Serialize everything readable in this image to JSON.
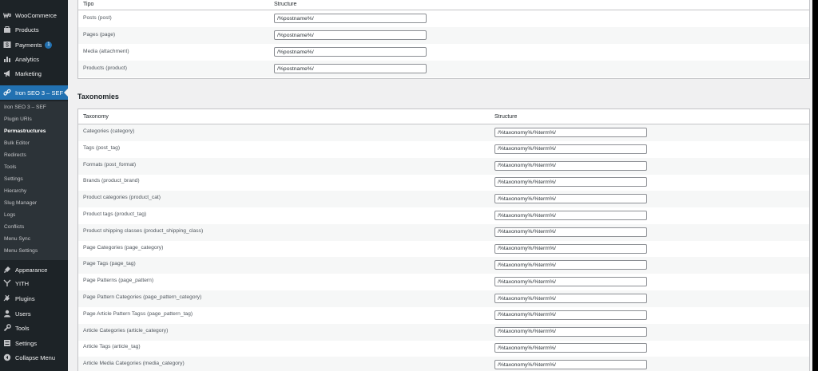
{
  "sidebar": {
    "top_items": [
      {
        "label": "WooCommerce",
        "icon": "woocommerce-icon"
      },
      {
        "label": "Products",
        "icon": "products-icon"
      },
      {
        "label": "Payments",
        "icon": "payments-icon",
        "badge": "1"
      },
      {
        "label": "Analytics",
        "icon": "analytics-icon"
      },
      {
        "label": "Marketing",
        "icon": "marketing-icon"
      }
    ],
    "active_item": {
      "label": "Iron SEO 3 – SEF",
      "icon": "link-icon"
    },
    "submenu": [
      {
        "label": "Iron SEO 3 – SEF"
      },
      {
        "label": "Plugin URIs"
      },
      {
        "label": "Permastructures",
        "current": true
      },
      {
        "label": "Bulk Editor"
      },
      {
        "label": "Redirects"
      },
      {
        "label": "Tools"
      },
      {
        "label": "Settings"
      },
      {
        "label": "Hierarchy"
      },
      {
        "label": "Slug Manager"
      },
      {
        "label": "Logs"
      },
      {
        "label": "Conflicts"
      },
      {
        "label": "Menu Sync"
      },
      {
        "label": "Menu Settings"
      }
    ],
    "bottom_items": [
      {
        "label": "Appearance",
        "icon": "appearance-icon"
      },
      {
        "label": "YITH",
        "icon": "yith-icon"
      },
      {
        "label": "Plugins",
        "icon": "plugins-icon"
      },
      {
        "label": "Users",
        "icon": "users-icon"
      },
      {
        "label": "Tools",
        "icon": "tools-icon"
      },
      {
        "label": "Settings",
        "icon": "settings-icon"
      },
      {
        "label": "Collapse Menu",
        "icon": "collapse-icon"
      }
    ]
  },
  "post_types": {
    "col_type": "Tipo",
    "col_structure": "Structure",
    "rows": [
      {
        "label": "Posts (post)",
        "value": "/%postname%/"
      },
      {
        "label": "Pages (page)",
        "value": "/%postname%/"
      },
      {
        "label": "Media (attachment)",
        "value": "/%postname%/"
      },
      {
        "label": "Products (product)",
        "value": "/%postname%/"
      }
    ]
  },
  "taxonomies": {
    "title": "Taxonomies",
    "col_taxonomy": "Taxonomy",
    "col_structure": "Structure",
    "rows": [
      {
        "label": "Categories (category)",
        "value": "/%taxonomy%/%term%/"
      },
      {
        "label": "Tags (post_tag)",
        "value": "/%taxonomy%/%term%/"
      },
      {
        "label": "Formats (post_format)",
        "value": "/%taxonomy%/%term%/"
      },
      {
        "label": "Brands (product_brand)",
        "value": "/%taxonomy%/%term%/"
      },
      {
        "label": "Product categories (product_cat)",
        "value": "/%taxonomy%/%term%/"
      },
      {
        "label": "Product tags (product_tag)",
        "value": "/%taxonomy%/%term%/"
      },
      {
        "label": "Product shipping classes (product_shipping_class)",
        "value": "/%taxonomy%/%term%/"
      },
      {
        "label": "Page Categories (page_category)",
        "value": "/%taxonomy%/%term%/"
      },
      {
        "label": "Page Tags (page_tag)",
        "value": "/%taxonomy%/%term%/"
      },
      {
        "label": "Page Patterns (page_pattern)",
        "value": "/%taxonomy%/%term%/"
      },
      {
        "label": "Page Pattern Categories (page_pattern_category)",
        "value": "/%taxonomy%/%term%/"
      },
      {
        "label": "Page Article Pattern Tagss (page_pattern_tag)",
        "value": "/%taxonomy%/%term%/"
      },
      {
        "label": "Article Categories (article_category)",
        "value": "/%taxonomy%/%term%/"
      },
      {
        "label": "Article Tags (article_tag)",
        "value": "/%taxonomy%/%term%/"
      },
      {
        "label": "Article Media Categories (media_category)",
        "value": "/%taxonomy%/%term%/"
      }
    ]
  }
}
